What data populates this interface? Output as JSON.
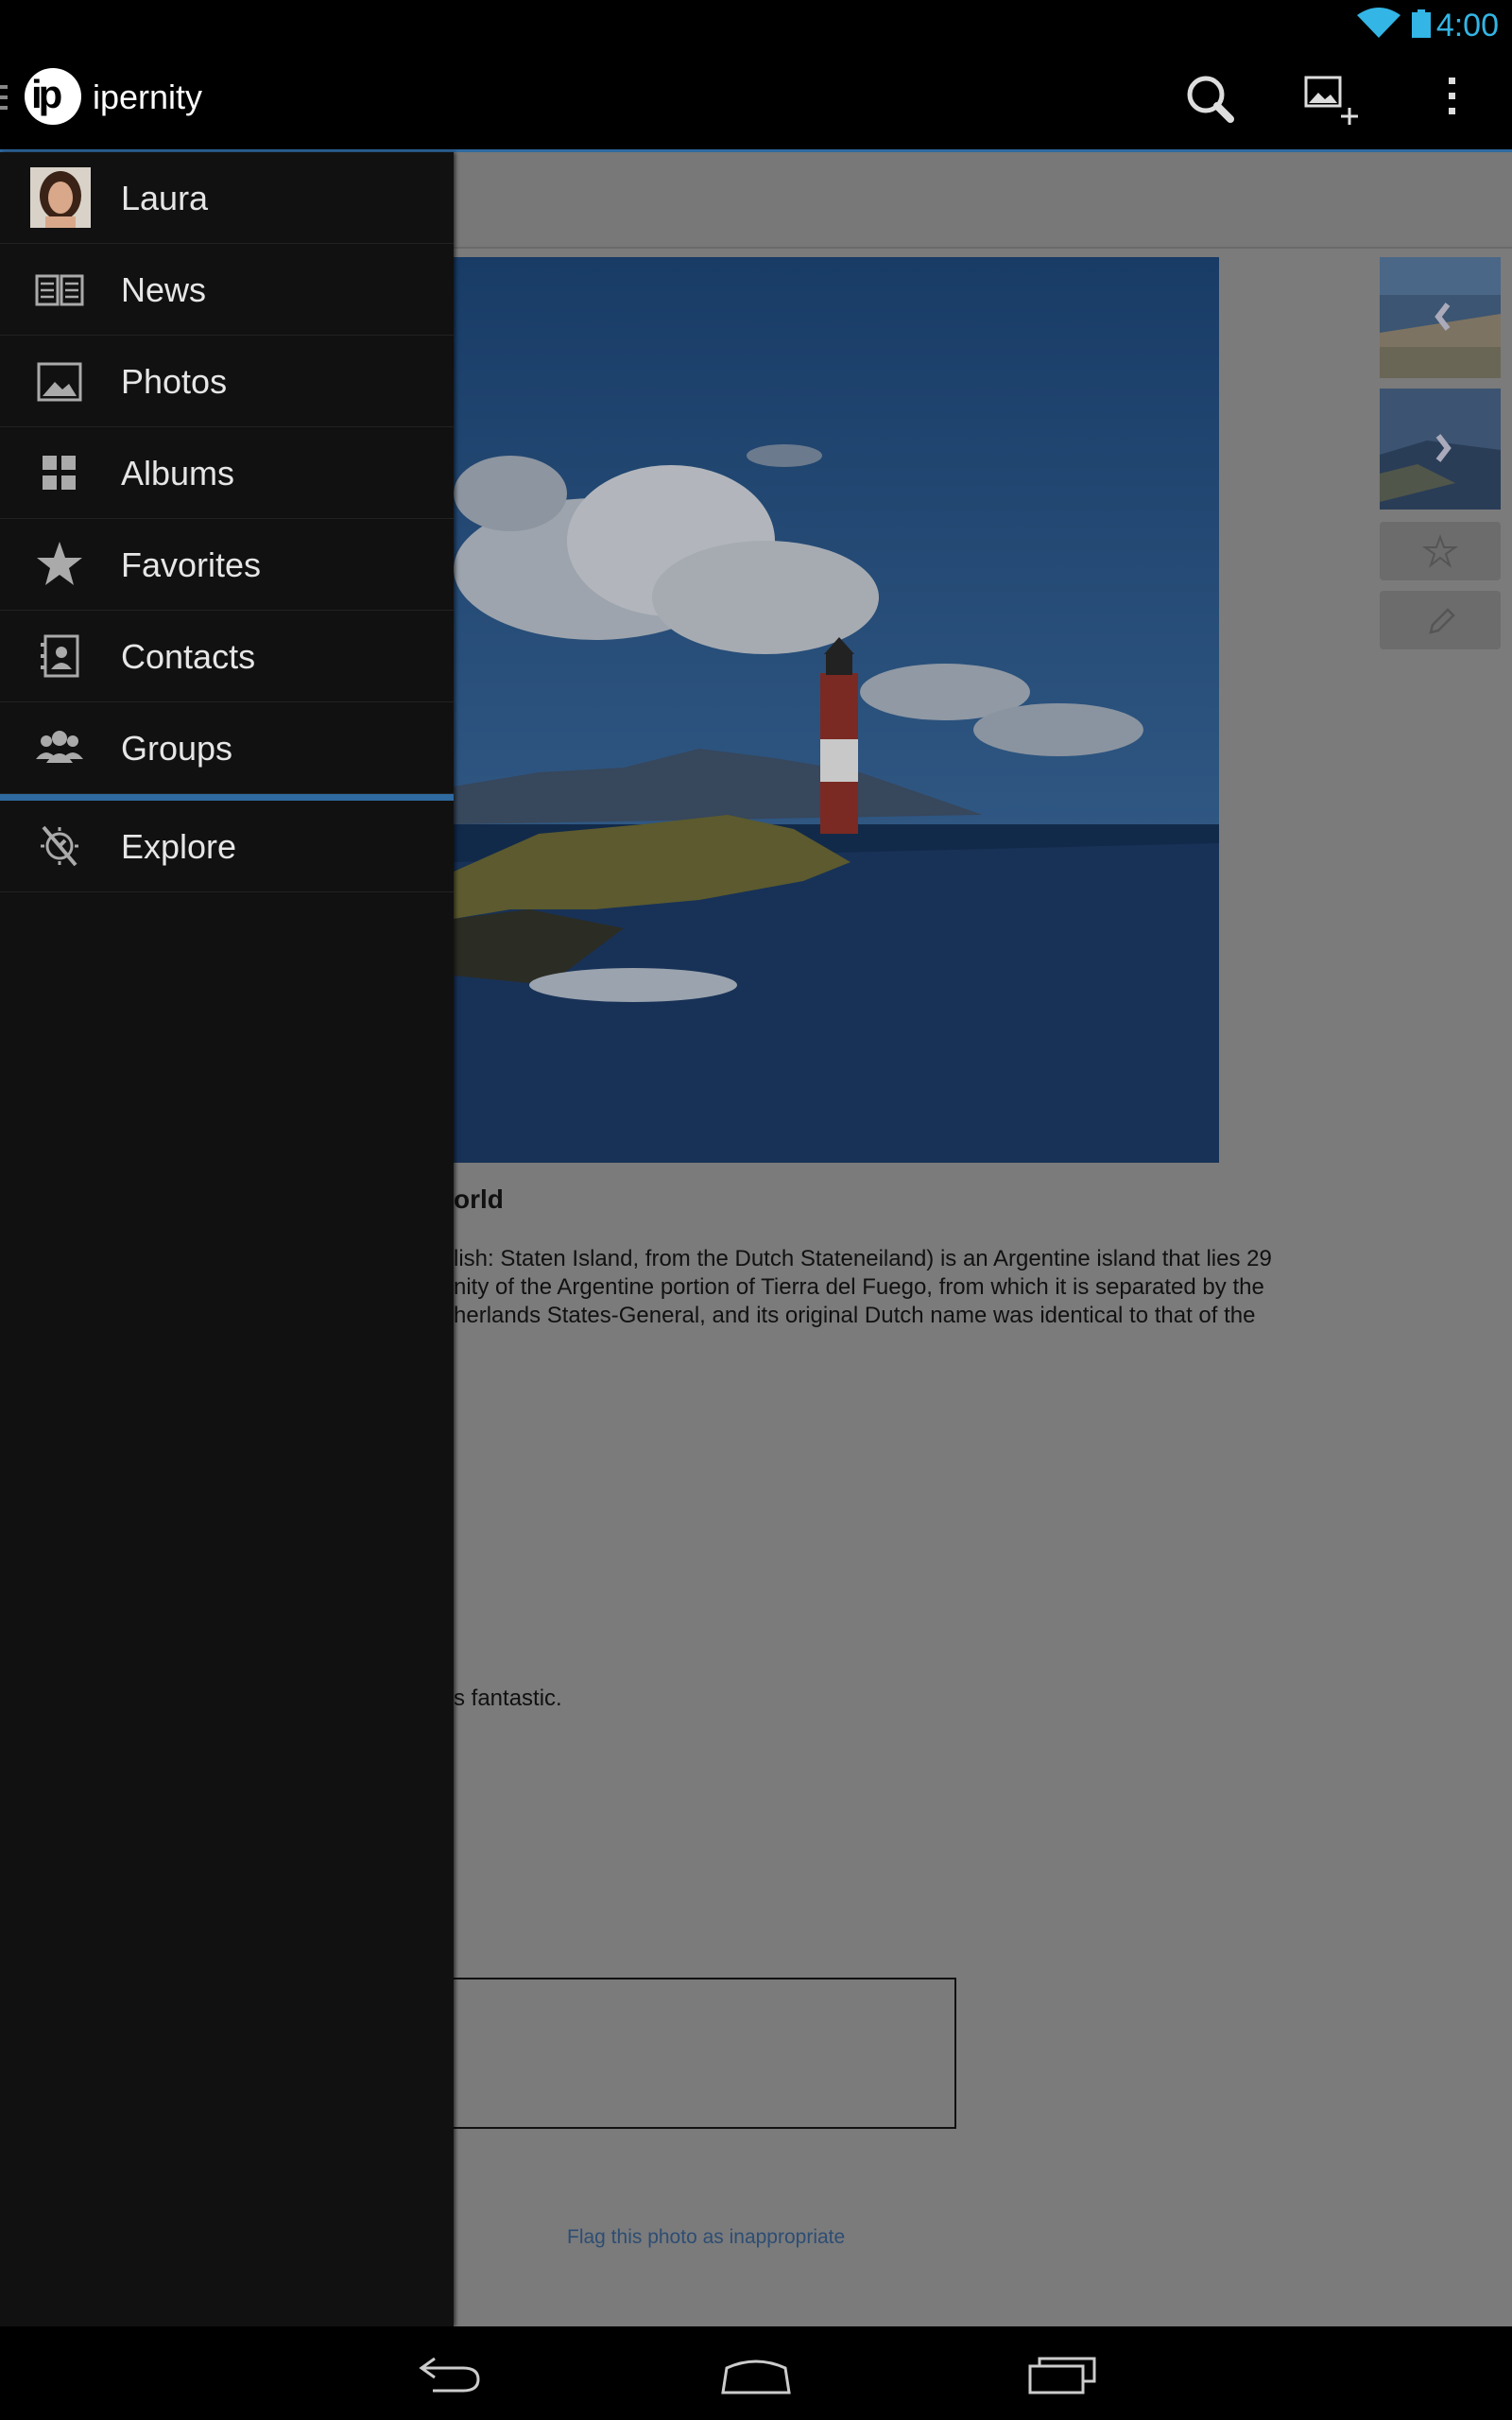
{
  "status_bar": {
    "time": "4:00",
    "wifi_icon": "wifi-icon",
    "battery_icon": "battery-icon"
  },
  "action_bar": {
    "app_name": "ipernity",
    "logo_text": "ip",
    "actions": [
      "search-icon",
      "add-photo-icon",
      "overflow-menu-icon"
    ]
  },
  "drawer": {
    "items": [
      {
        "label": "Laura",
        "icon": "avatar"
      },
      {
        "label": "News",
        "icon": "news-icon"
      },
      {
        "label": "Photos",
        "icon": "photos-icon"
      },
      {
        "label": "Albums",
        "icon": "albums-icon"
      },
      {
        "label": "Favorites",
        "icon": "star-icon"
      },
      {
        "label": "Contacts",
        "icon": "contacts-icon"
      },
      {
        "label": "Groups",
        "icon": "groups-icon"
      },
      {
        "label": "Explore",
        "icon": "explore-icon"
      }
    ]
  },
  "content": {
    "photo_title_visible": "orld",
    "description_lines": [
      "lish: Staten Island, from the Dutch Stateneiland) is an Argentine island that lies 29",
      "nity of the Argentine portion of Tierra del Fuego, from which it is separated by the",
      "herlands States-General, and its original Dutch name was identical to that of the"
    ],
    "comment_visible": "s fantastic.",
    "flag_link": "Flag this photo as inappropriate"
  },
  "colors": {
    "accent": "#33b5e5",
    "drawer_bg": "#111111",
    "separator": "#2f6aa1"
  },
  "navbar": {
    "buttons": [
      "back-icon",
      "home-icon",
      "recent-apps-icon"
    ]
  }
}
